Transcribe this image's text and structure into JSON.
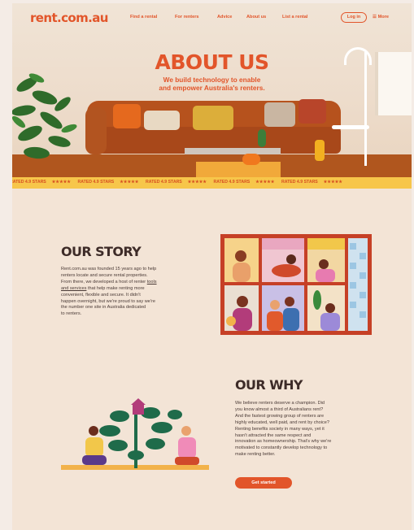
{
  "header": {
    "logo": "rent.com.au",
    "nav": [
      "Find a rental",
      "For renters",
      "Advice",
      "About us",
      "List a rental"
    ],
    "login": "Log in",
    "more": "☰  More"
  },
  "hero": {
    "title": "ABOUT US",
    "subtitle_lines": [
      "We build technology to enable",
      "and empower Australia's renters."
    ]
  },
  "ratings_strip": {
    "text": "RATED 4.9 STARS",
    "stars": "★★★★★",
    "repeat": 5
  },
  "our_story": {
    "heading": "OUR STORY",
    "lines": [
      "Rent.com.au was founded 15 years ago to help",
      "renters locate and secure rental properties.",
      [
        "From there, we developed a host of renter ",
        "tools"
      ],
      [
        "and services",
        " that help make renting more"
      ],
      "convenient, flexible and secure. It didn't",
      "happen overnight, but we're proud to say we're",
      "the number one site in Australia dedicated",
      "to renters."
    ]
  },
  "our_why": {
    "heading": "OUR WHY",
    "lines": [
      "We believe renters deserve a champion. Did",
      "you know almost a third of Australians rent?",
      "And the fastest growing group of renters are",
      "highly educated, well paid, and rent by choice?",
      "Renting benefits society in many ways, yet it",
      "hasn't attracted the same respect and",
      "innovation as homeownership. That's why we're",
      "motivated to constantly develop technology to",
      "make renting better."
    ],
    "button": "Get started"
  },
  "colors": {
    "brand": "#e2552a",
    "page_bg": "#f3e4d6",
    "heading": "#3d2b28",
    "strip": "#f7c64a"
  }
}
